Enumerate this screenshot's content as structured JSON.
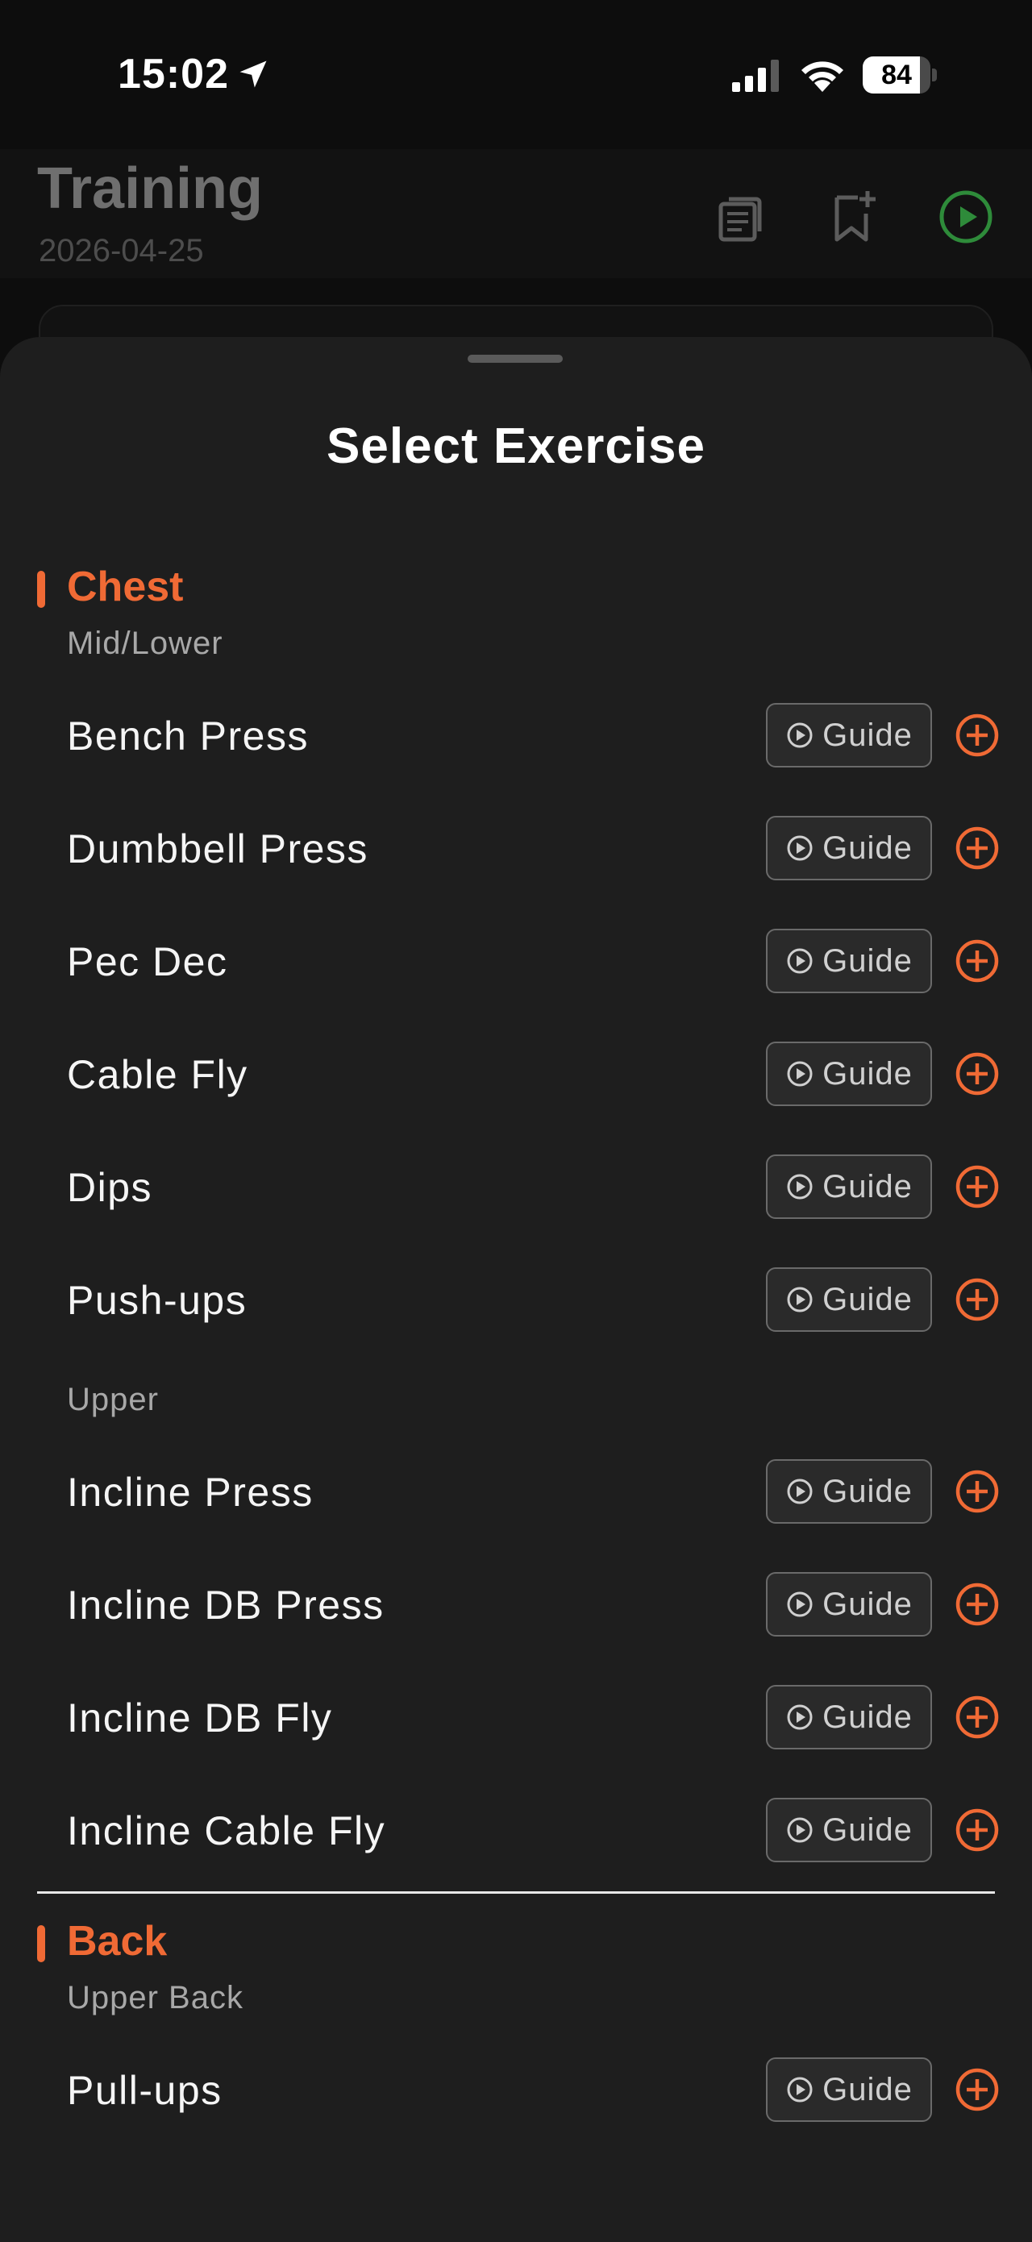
{
  "status": {
    "time": "15:02",
    "battery": "84",
    "battery_level": 0.84
  },
  "header": {
    "title": "Training",
    "date": "2026-04-25"
  },
  "sheet": {
    "title": "Select Exercise",
    "guide_label": "Guide",
    "groups": [
      {
        "name": "Chest",
        "subgroups": [
          {
            "name": "Mid/Lower",
            "exercises": [
              "Bench Press",
              "Dumbbell Press",
              "Pec Dec",
              "Cable Fly",
              "Dips",
              "Push-ups"
            ]
          },
          {
            "name": "Upper",
            "exercises": [
              "Incline Press",
              "Incline DB Press",
              "Incline DB Fly",
              "Incline Cable Fly"
            ]
          }
        ]
      },
      {
        "name": "Back",
        "subgroups": [
          {
            "name": "Upper Back",
            "exercises": [
              "Pull-ups"
            ]
          }
        ]
      }
    ]
  },
  "colors": {
    "accent": "#f06a35",
    "play_green": "#2e8b3a"
  }
}
